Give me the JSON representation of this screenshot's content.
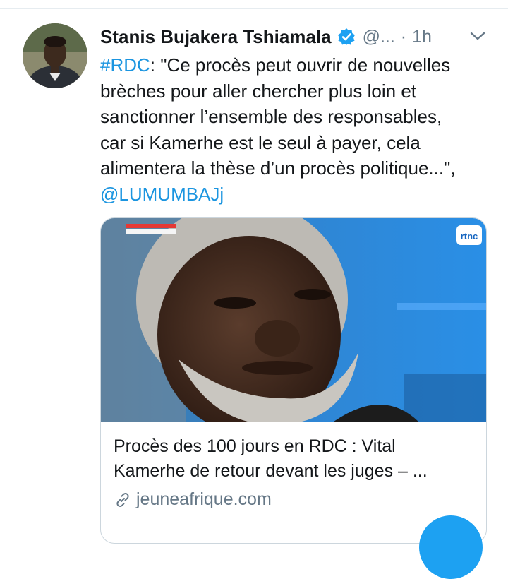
{
  "tweet": {
    "author_name": "Stanis Bujakera Tshiamala",
    "handle": "@...",
    "separator": "·",
    "time": "1h",
    "hashtag": "#RDC",
    "body_lines": [
      ": \"Ce procès peut ouvrir de nouvelles",
      "brèches pour aller chercher plus loin et",
      "sanctionner l’ensemble des responsables,",
      "car si Kamerhe est le seul à payer, cela",
      "alimentera la thèse d’un procès politique...\","
    ],
    "mention": "@LUMUMBAJj"
  },
  "card": {
    "title_line1": "Procès des 100 jours en RDC : Vital",
    "title_line2": "Kamerhe de retour devant les juges – ...",
    "domain": "jeuneafrique.com",
    "tv_logo_text": "rtnc"
  },
  "icons": {
    "verified": "verified-badge-icon",
    "menu": "chevron-down-icon",
    "link": "link-icon",
    "compose": "compose-fab"
  },
  "colors": {
    "link": "#1b95e0",
    "secondary_text": "#657786",
    "verified": "#1da1f2",
    "border": "#ccd6dd"
  }
}
